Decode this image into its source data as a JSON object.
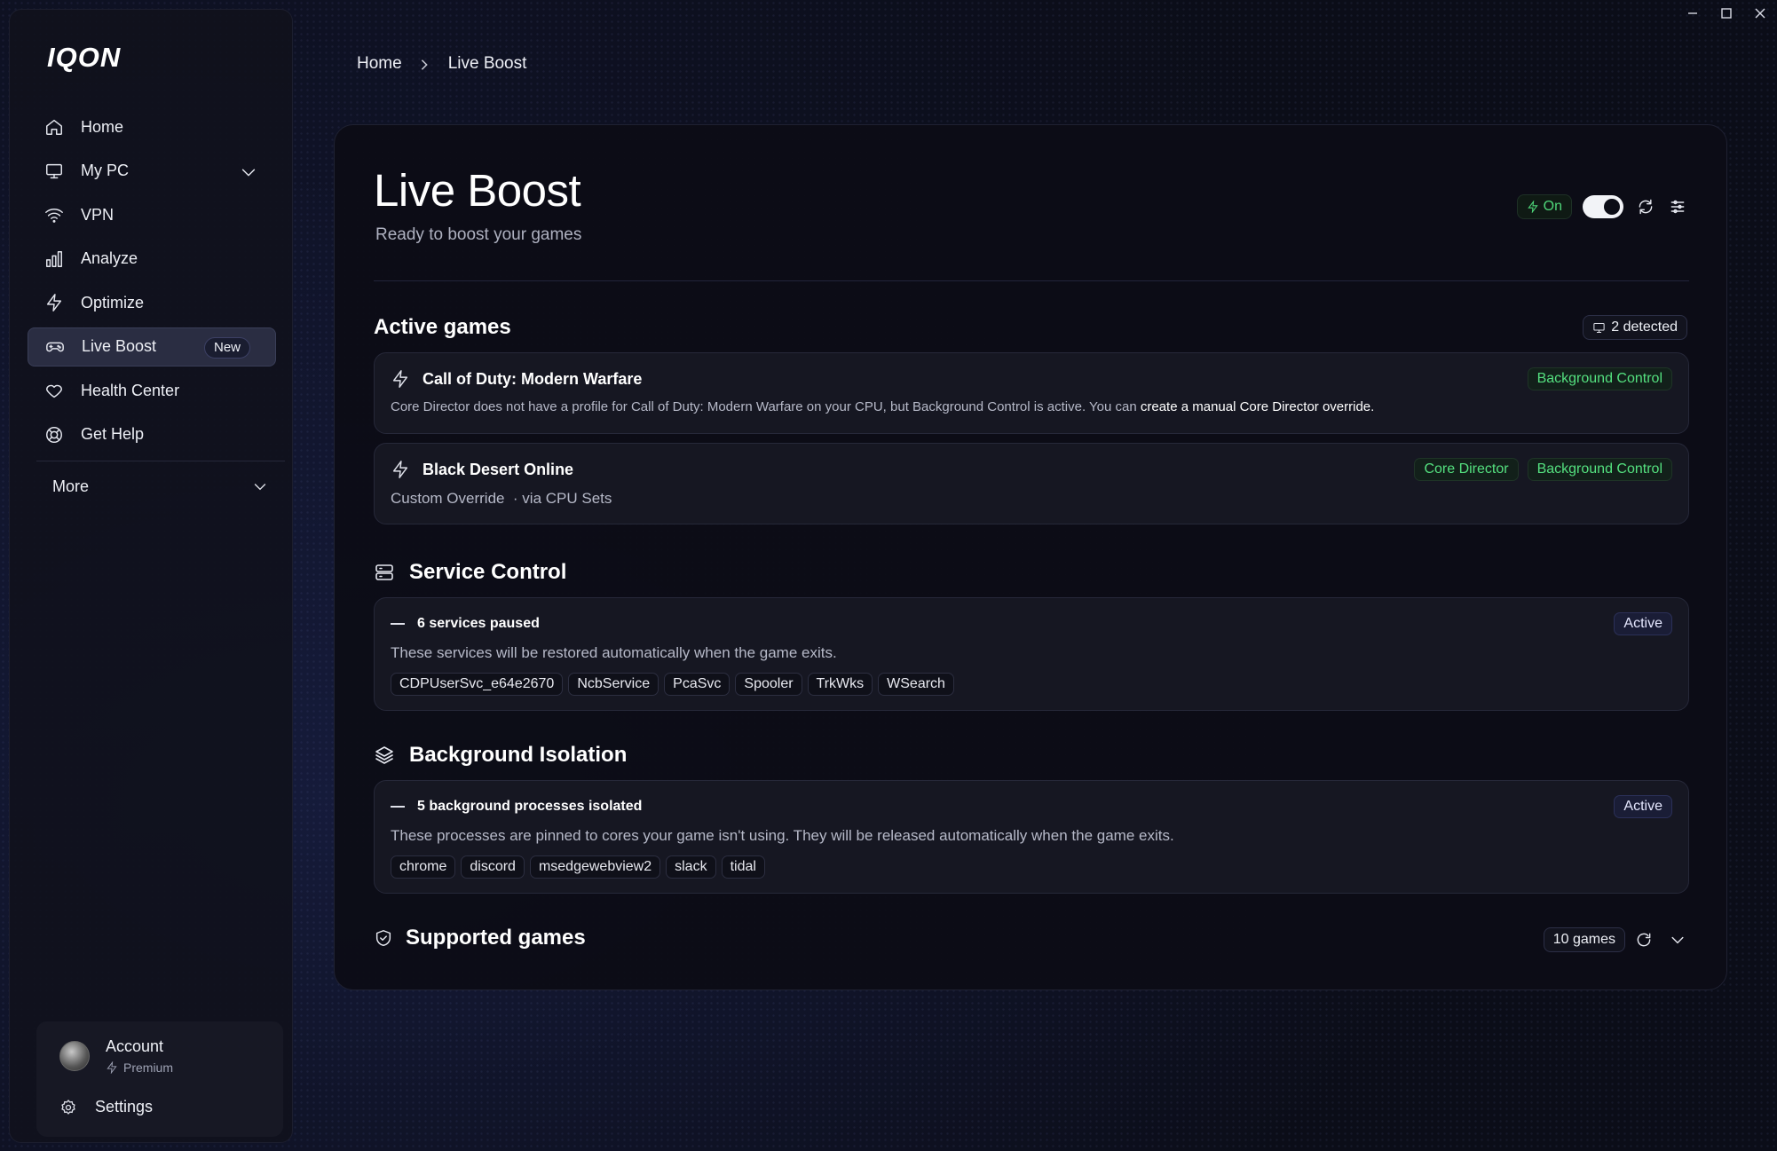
{
  "window": {
    "controls": [
      "minimize",
      "maximize",
      "close"
    ]
  },
  "sidebar": {
    "logo": "IQON",
    "items": [
      {
        "label": "Home",
        "icon": "home-icon"
      },
      {
        "label": "My PC",
        "icon": "monitor-icon",
        "expandable": true
      },
      {
        "label": "VPN",
        "icon": "wifi-icon"
      },
      {
        "label": "Analyze",
        "icon": "bar-chart-icon"
      },
      {
        "label": "Optimize",
        "icon": "lightning-icon"
      },
      {
        "label": "Live Boost",
        "icon": "gamepad-icon",
        "active": true,
        "badge": "New"
      },
      {
        "label": "Health Center",
        "icon": "heart-icon"
      },
      {
        "label": "Get Help",
        "icon": "lifebuoy-icon"
      }
    ],
    "more_label": "More",
    "account": {
      "name": "Account",
      "tier": "Premium"
    },
    "settings_label": "Settings"
  },
  "breadcrumb": {
    "home": "Home",
    "current": "Live Boost"
  },
  "header": {
    "title": "Live Boost",
    "subtitle": "Ready to boost your games",
    "status_label": "On",
    "toggle_on": true
  },
  "active_games": {
    "title": "Active games",
    "detected_label": "2 detected",
    "games": [
      {
        "name": "Call of Duty: Modern Warfare",
        "description_prefix": "Core Director does not have a profile for Call of Duty: Modern Warfare on your CPU, but Background Control is active. You can ",
        "description_link": "create a manual Core Director override.",
        "tags": [
          "Background Control"
        ]
      },
      {
        "name": "Black Desert Online",
        "description": "Custom Override  · via CPU Sets",
        "tags": [
          "Core Director",
          "Background Control"
        ]
      }
    ]
  },
  "service_control": {
    "title": "Service Control",
    "summary": "6 services paused",
    "status": "Active",
    "description": "These services will be restored automatically when the game exits.",
    "services": [
      "CDPUserSvc_e64e2670",
      "NcbService",
      "PcaSvc",
      "Spooler",
      "TrkWks",
      "WSearch"
    ]
  },
  "background_isolation": {
    "title": "Background Isolation",
    "summary": "5 background processes isolated",
    "status": "Active",
    "description": "These processes are pinned to cores your game isn't using. They will be released automatically when the game exits.",
    "processes": [
      "chrome",
      "discord",
      "msedgewebview2",
      "slack",
      "tidal"
    ]
  },
  "supported_games": {
    "title": "Supported games",
    "count_label": "10 games"
  }
}
